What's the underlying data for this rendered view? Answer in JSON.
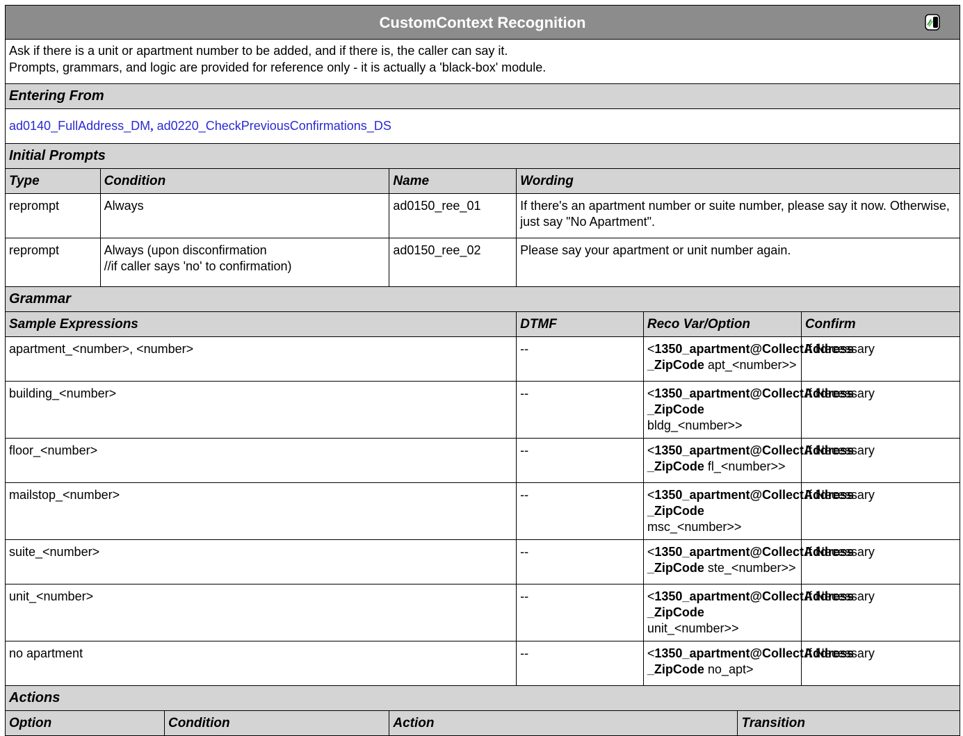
{
  "header": {
    "title": "CustomContext Recognition",
    "icon": "recognition-speaker-icon"
  },
  "description": {
    "line1": "Ask if there is a unit or apartment number to be added, and if there is, the caller can say it.",
    "line2": "Prompts, grammars, and logic are provided for reference only  - it is actually a 'black-box' module."
  },
  "entering_from": {
    "label": "Entering From",
    "links": [
      "ad0140_FullAddress_DM",
      "ad0220_CheckPreviousConfirmations_DS"
    ],
    "separator": ","
  },
  "initial_prompts": {
    "label": "Initial Prompts",
    "columns": [
      "Type",
      "Condition",
      "Name",
      "Wording"
    ],
    "rows": [
      {
        "type": "reprompt",
        "condition_line1": "Always",
        "condition_line2": "",
        "name": "ad0150_ree_01",
        "wording": "If there's an apartment number or suite number, please say it now. Otherwise, just say \"No Apartment\"."
      },
      {
        "type": "reprompt",
        "condition_line1": "Always (upon disconfirmation",
        "condition_line2": "//if caller says 'no' to confirmation)",
        "name": "ad0150_ree_02",
        "wording": "Please say your apartment or unit number again."
      }
    ]
  },
  "grammar": {
    "label": "Grammar",
    "columns": [
      "Sample Expressions",
      "DTMF",
      "Reco Var/Option",
      "Confirm"
    ],
    "reco_prefix": "<",
    "reco_var_line1": "1350_apartment@CollectAddress",
    "reco_var_line2": "_ZipCode",
    "rows": [
      {
        "expression": "apartment_<number>, <number>",
        "dtmf": "--",
        "reco_option": "apt_<number>>",
        "confirm": "If Necessary"
      },
      {
        "expression": "building_<number>",
        "dtmf": "--",
        "reco_option": "bldg_<number>>",
        "confirm": "If Necessary"
      },
      {
        "expression": "floor_<number>",
        "dtmf": "--",
        "reco_option": "fl_<number>>",
        "confirm": "If Necessary"
      },
      {
        "expression": "mailstop_<number>",
        "dtmf": "--",
        "reco_option": "msc_<number>>",
        "confirm": "If Necessary"
      },
      {
        "expression": "suite_<number>",
        "dtmf": "--",
        "reco_option": "ste_<number>>",
        "confirm": "If Necessary"
      },
      {
        "expression": "unit_<number>",
        "dtmf": "--",
        "reco_option": "unit_<number>>",
        "confirm": "If Necessary"
      },
      {
        "expression": "no apartment",
        "dtmf": "--",
        "reco_option": "no_apt>",
        "confirm": "If Necessary"
      }
    ]
  },
  "actions": {
    "label": "Actions",
    "columns": [
      "Option",
      "Condition",
      "Action",
      "Transition"
    ]
  }
}
